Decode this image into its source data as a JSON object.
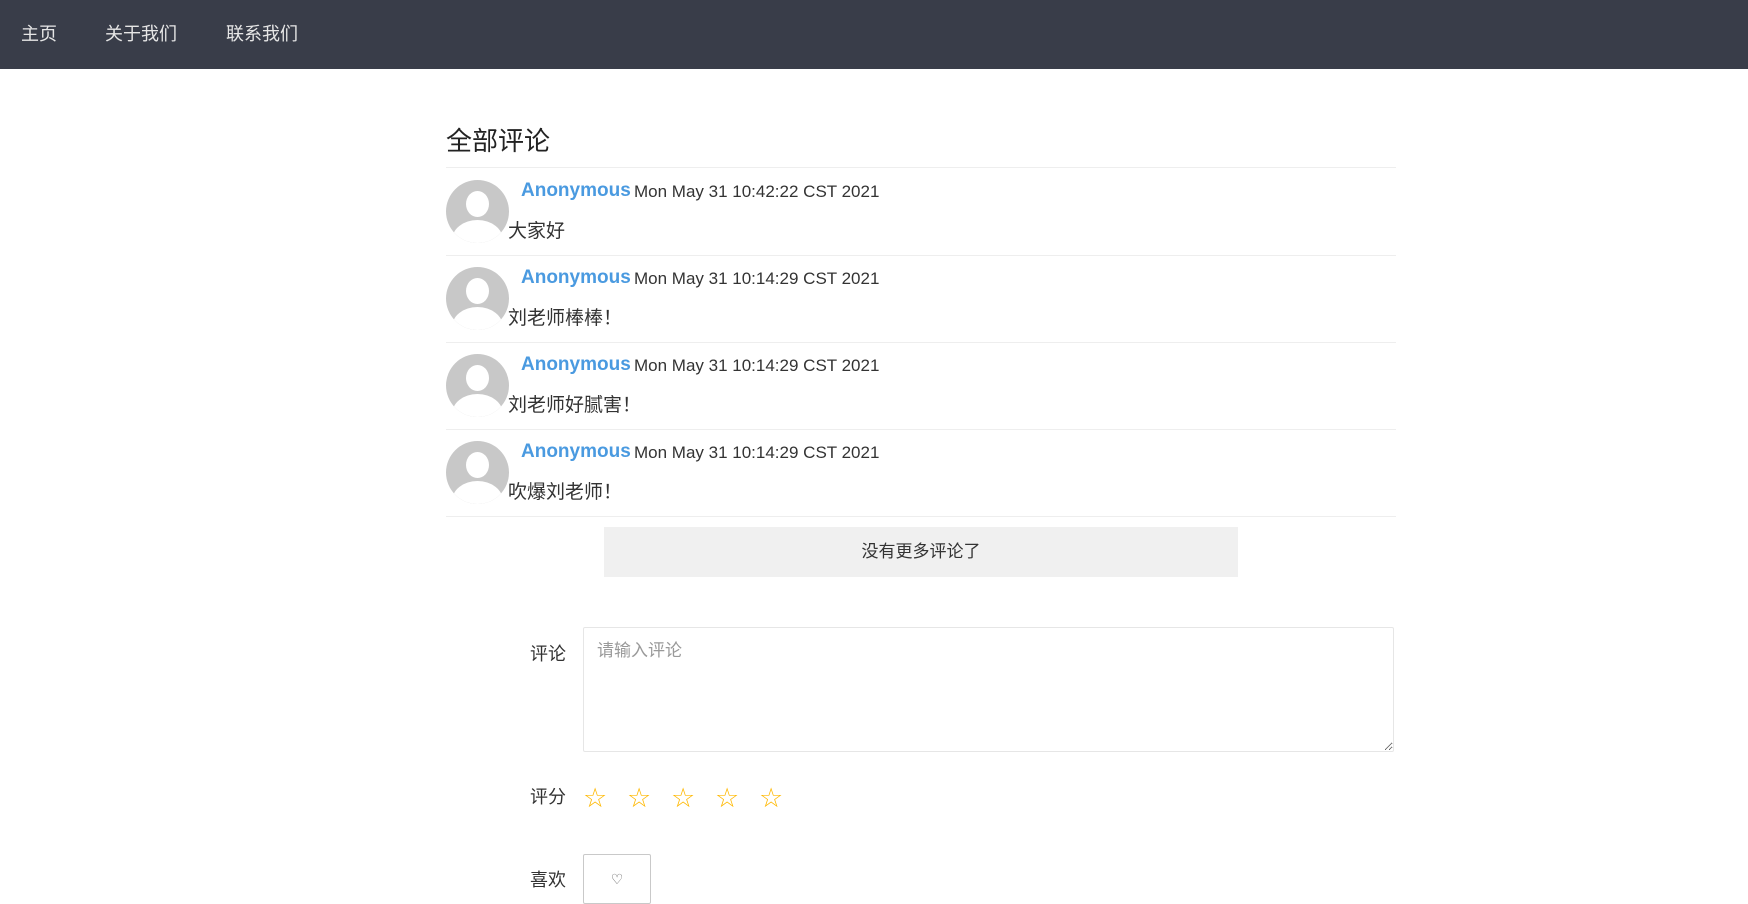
{
  "nav": {
    "items": [
      {
        "label": "主页"
      },
      {
        "label": "关于我们"
      },
      {
        "label": "联系我们"
      }
    ]
  },
  "comments_section": {
    "title": "全部评论",
    "comments": [
      {
        "author": "Anonymous",
        "time": "Mon May 31 10:42:22 CST 2021",
        "text": "大家好"
      },
      {
        "author": "Anonymous",
        "time": "Mon May 31 10:14:29 CST 2021",
        "text": "刘老师棒棒！"
      },
      {
        "author": "Anonymous",
        "time": "Mon May 31 10:14:29 CST 2021",
        "text": "刘老师好腻害！"
      },
      {
        "author": "Anonymous",
        "time": "Mon May 31 10:14:29 CST 2021",
        "text": "吹爆刘老师！"
      }
    ],
    "no_more_label": "没有更多评论了"
  },
  "form": {
    "comment_label": "评论",
    "comment_placeholder": "请输入评论",
    "comment_value": "",
    "rating_label": "评分",
    "rating_value": 0,
    "rating_max": 5,
    "star_icon": "star-outline-icon",
    "like_label": "喜欢",
    "like_icon": "heart-outline-icon",
    "like_glyph": "♡"
  },
  "colors": {
    "nav_bg": "#393d49",
    "author": "#4a9ae0",
    "star": "#ffb800"
  }
}
